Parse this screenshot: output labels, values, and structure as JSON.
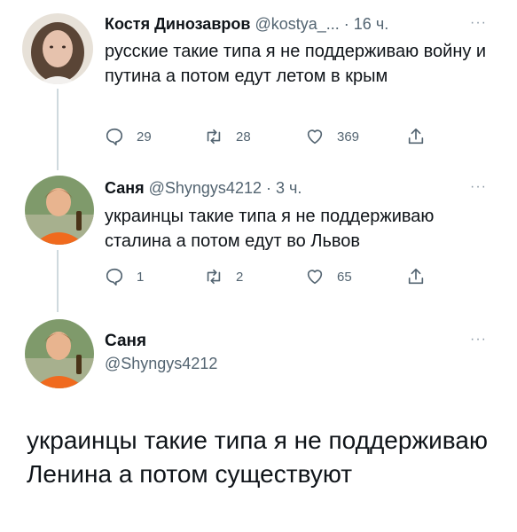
{
  "tweets": [
    {
      "name": "Костя Динозавров",
      "handle": "@kostya_...",
      "separator": "·",
      "time": "16 ч.",
      "more": "···",
      "text": "русские такие типа я не поддерживаю войну и путина а потом едут летом в крым",
      "replies": "29",
      "retweets": "28",
      "likes": "369"
    },
    {
      "name": "Саня",
      "handle": "@Shyngys4212",
      "separator": "·",
      "time": "3 ч.",
      "more": "···",
      "text": "украинцы такие типа я не поддерживаю сталина а потом едут во Львов",
      "replies": "1",
      "retweets": "2",
      "likes": "65"
    }
  ],
  "main_tweet": {
    "name": "Саня",
    "handle": "@Shyngys4212",
    "more": "···",
    "text": "украинцы такие типа я не поддерживаю Ленина а потом существуют"
  },
  "colors": {
    "text": "#0f1419",
    "secondary": "#536471",
    "thread_line": "#cfd9de"
  }
}
